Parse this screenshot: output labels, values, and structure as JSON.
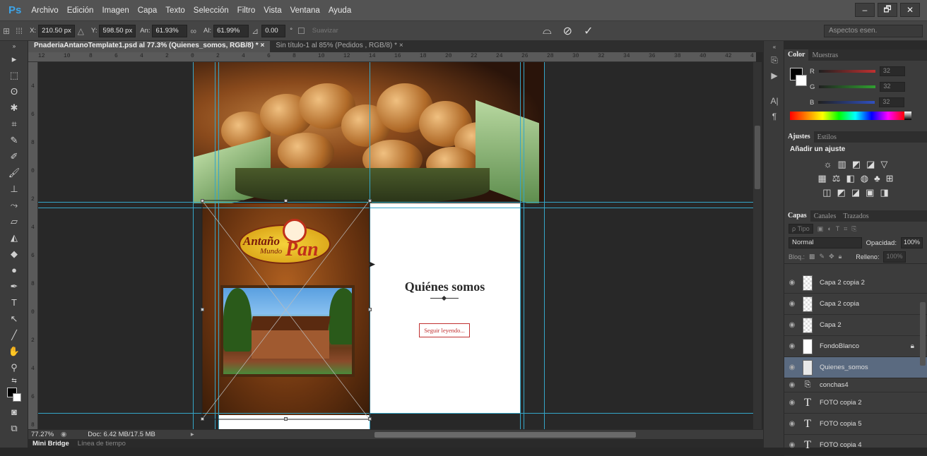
{
  "app": {
    "logo": "Ps"
  },
  "menu": [
    "Archivo",
    "Edición",
    "Imagen",
    "Capa",
    "Texto",
    "Selección",
    "Filtro",
    "Vista",
    "Ventana",
    "Ayuda"
  ],
  "window_controls": {
    "minimize": "–",
    "restore": "🗗",
    "close": "✕"
  },
  "options": {
    "x_label": "X:",
    "x_value": "210.50 px",
    "y_label": "Y:",
    "y_value": "598.50 px",
    "w_label": "An:",
    "w_value": "61.93%",
    "h_label": "Al:",
    "h_value": "61.99%",
    "angle_value": "0.00",
    "angle_unit": "°",
    "smooth_label": "Suavizar",
    "workspace": "Aspectos esen."
  },
  "tabs": [
    {
      "label": "PnaderiaAntanoTemplate1.psd al 77.3% (Quienes_somos, RGB/8) *",
      "active": true
    },
    {
      "label": "Sin título-1 al 85% (Pedidos , RGB/8) *",
      "active": false
    }
  ],
  "ruler_h_ticks": [
    "12",
    "10",
    "8",
    "6",
    "4",
    "2",
    "0",
    "2",
    "4",
    "6",
    "8",
    "10",
    "12",
    "14",
    "16",
    "18",
    "20",
    "22",
    "24",
    "26",
    "28",
    "30",
    "32",
    "34",
    "36",
    "38",
    "40",
    "42",
    "4"
  ],
  "ruler_v_ticks": [
    "4",
    "6",
    "8",
    "0",
    "2",
    "4",
    "6",
    "8",
    "0",
    "2",
    "4",
    "6",
    "8"
  ],
  "document": {
    "logo_line1": "Antaño",
    "logo_line2": "Mundo",
    "logo_line3": "Pan",
    "section_title": "Quiénes somos",
    "button_label": "Seguir leyendo..."
  },
  "status": {
    "zoom": "77.27%",
    "doc": "Doc: 6.42 MB/17.5 MB"
  },
  "bottom_tabs": [
    "Mini Bridge",
    "Línea de tiempo"
  ],
  "color_panel": {
    "tabs": [
      "Color",
      "Muestras"
    ],
    "r_label": "R",
    "g_label": "G",
    "b_label": "B",
    "r_value": "32",
    "g_value": "32",
    "b_value": "32",
    "r_color": "#c03030",
    "g_color": "#30a030",
    "b_color": "#3050c0"
  },
  "ajustes_panel": {
    "tabs": [
      "Ajustes",
      "Estilos"
    ],
    "title": "Añadir un ajuste"
  },
  "layers_panel": {
    "tabs": [
      "Capas",
      "Canales",
      "Trazados"
    ],
    "filter_label": "ρ Tipo",
    "blend_mode": "Normal",
    "opacity_label": "Opacidad:",
    "opacity_value": "100%",
    "lock_label": "Bloq.:",
    "fill_label": "Relleno:",
    "fill_value": "100%",
    "layers": [
      {
        "name": "Capa 2 copia 2",
        "type": "raster",
        "selected": false
      },
      {
        "name": "Capa 2 copia",
        "type": "raster",
        "selected": false
      },
      {
        "name": "Capa 2",
        "type": "raster",
        "selected": false
      },
      {
        "name": "FondoBlanco",
        "type": "raster",
        "selected": false,
        "locked": true
      },
      {
        "name": "Quienes_somos",
        "type": "raster",
        "selected": true
      },
      {
        "name": "conchas4",
        "type": "smart",
        "selected": false
      },
      {
        "name": "FOTO copia 2",
        "type": "text",
        "selected": false
      },
      {
        "name": "FOTO copia 5",
        "type": "text",
        "selected": false
      },
      {
        "name": "FOTO copia 4",
        "type": "text",
        "selected": false
      }
    ]
  },
  "accent_color": "#35a6c8"
}
